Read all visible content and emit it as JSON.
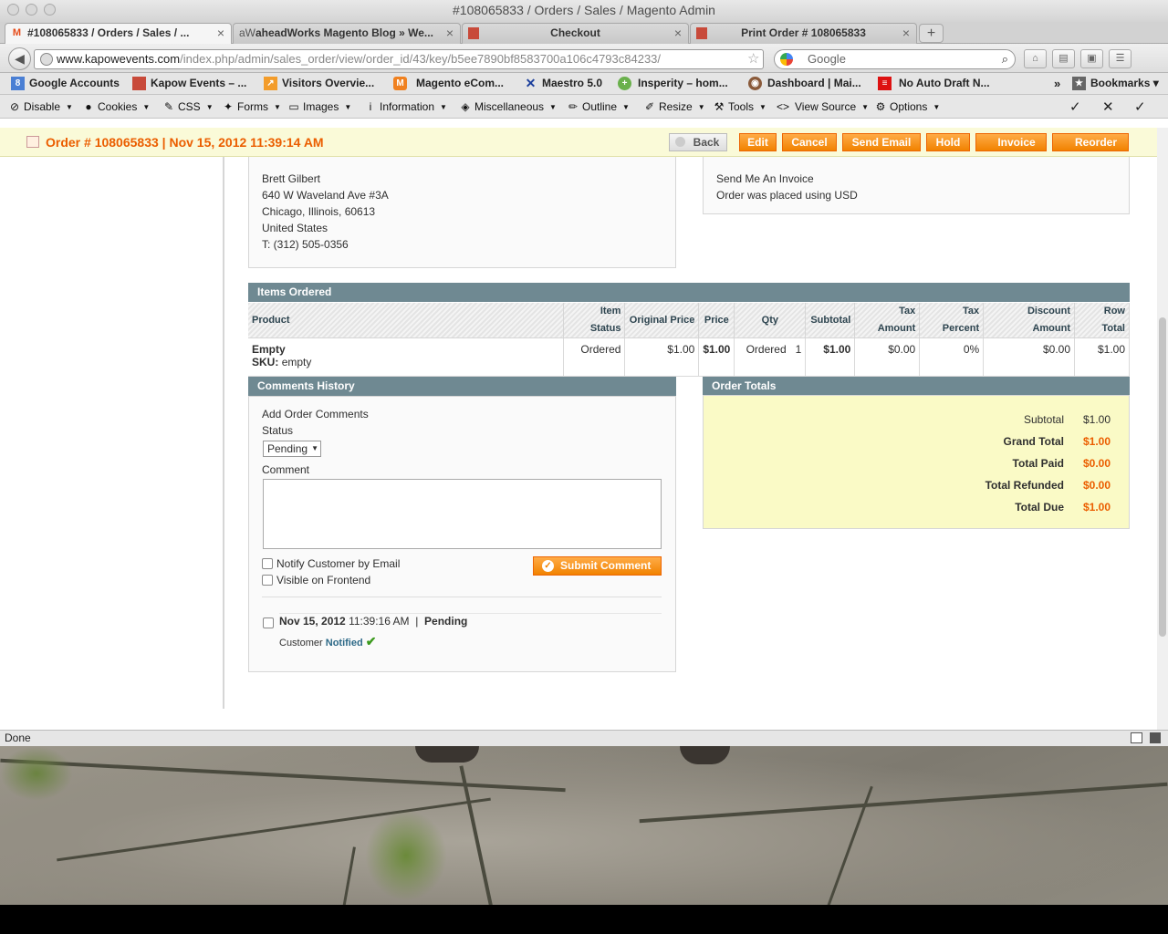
{
  "window": {
    "title": "#108065833 / Orders / Sales / Magento Admin"
  },
  "tabs": [
    {
      "label": "#108065833 / Orders / Sales / ...",
      "icon": "magento-icon"
    },
    {
      "label": "aheadWorks Magento Blog » We...",
      "icon": "aw-icon"
    },
    {
      "label": "Checkout",
      "icon": "bookmark-icon"
    },
    {
      "label": "Print Order # 108065833",
      "icon": "bookmark-icon"
    }
  ],
  "url": {
    "domain": "www.kapowevents.com",
    "path": "/index.php/admin/sales_order/view/order_id/43/key/b5ee7890bf8583700a106c4793c84233/"
  },
  "search": {
    "placeholder": "Google"
  },
  "bookmarks": [
    "Google Accounts",
    "Kapow Events – ...",
    "Visitors Overvie...",
    "Magento eCom...",
    "Maestro 5.0",
    "Insperity – hom...",
    "Dashboard | Mai...",
    "No Auto Draft N...",
    "Bookmarks"
  ],
  "devtools": [
    "Disable",
    "Cookies",
    "CSS",
    "Forms",
    "Images",
    "Information",
    "Miscellaneous",
    "Outline",
    "Resize",
    "Tools",
    "View Source",
    "Options"
  ],
  "order_header": {
    "title": "Order # 108065833 | Nov 15, 2012 11:39:14 AM",
    "buttons": {
      "back": "Back",
      "edit": "Edit",
      "cancel": "Cancel",
      "send_email": "Send Email",
      "hold": "Hold",
      "invoice": "Invoice",
      "reorder": "Reorder"
    }
  },
  "billing": {
    "name": "Brett Gilbert",
    "street": "640 W Waveland Ave #3A",
    "city": "Chicago, Illinois, 60613",
    "country": "United States",
    "phone": "T: (312) 505-0356"
  },
  "payment": {
    "method": "Send Me An Invoice",
    "currency_note": "Order was placed using USD"
  },
  "items": {
    "title": "Items Ordered",
    "columns": [
      "Product",
      "Item Status",
      "Original Price",
      "Price",
      "Qty",
      "Subtotal",
      "Tax Amount",
      "Tax Percent",
      "Discount Amount",
      "Row Total"
    ],
    "row": {
      "product": "Empty",
      "sku_label": "SKU:",
      "sku": "empty",
      "status": "Ordered",
      "original_price": "$1.00",
      "price": "$1.00",
      "qty_label": "Ordered",
      "qty": "1",
      "subtotal": "$1.00",
      "tax_amount": "$0.00",
      "tax_percent": "0%",
      "discount": "$0.00",
      "row_total": "$1.00"
    }
  },
  "comments": {
    "title": "Comments History",
    "add_label": "Add Order Comments",
    "status_label": "Status",
    "status_value": "Pending",
    "comment_label": "Comment",
    "notify_label": "Notify Customer by Email",
    "visible_label": "Visible on Frontend",
    "submit": "Submit Comment",
    "history": {
      "date": "Nov 15, 2012",
      "time": "11:39:16 AM",
      "sep": "|",
      "status": "Pending",
      "customer": "Customer",
      "notified": "Notified"
    }
  },
  "totals": {
    "title": "Order Totals",
    "subtotal_label": "Subtotal",
    "subtotal": "$1.00",
    "grand_label": "Grand Total",
    "grand": "$1.00",
    "paid_label": "Total Paid",
    "paid": "$0.00",
    "refunded_label": "Total Refunded",
    "refunded": "$0.00",
    "due_label": "Total Due",
    "due": "$1.00"
  },
  "status_bar": "Done",
  "colors": {
    "accent": "#eb5e00",
    "section_header": "#6f8992",
    "header_bg": "#fafad8"
  }
}
